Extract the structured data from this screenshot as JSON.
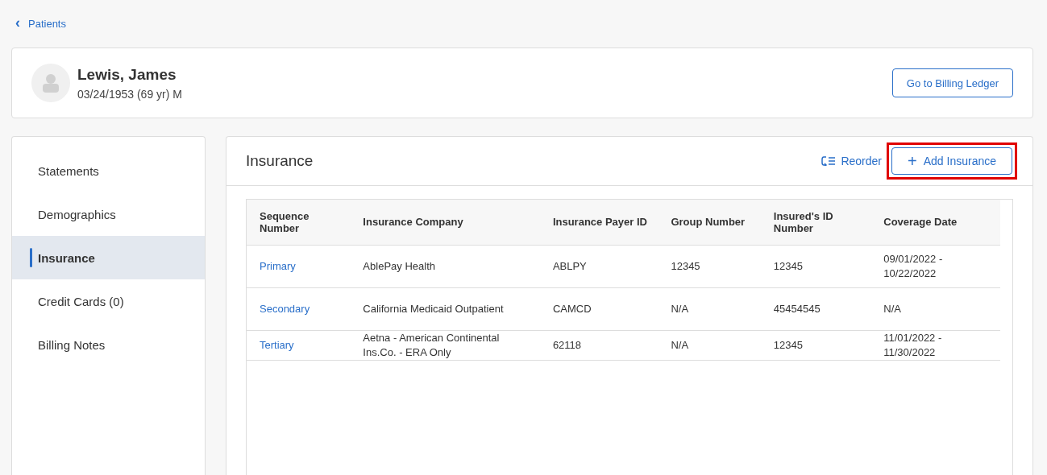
{
  "back_link": {
    "icon": "‹",
    "label": "Patients"
  },
  "patient": {
    "name": "Lewis, James",
    "details": "03/24/1953 (69 yr) M",
    "action": "Go to Billing Ledger"
  },
  "sidebar": {
    "items": [
      {
        "label": "Statements",
        "selected": false
      },
      {
        "label": "Demographics",
        "selected": false
      },
      {
        "label": "Insurance",
        "selected": true
      },
      {
        "label": "Credit Cards (0)",
        "selected": false
      },
      {
        "label": "Billing Notes",
        "selected": false
      }
    ]
  },
  "panel": {
    "title": "Insurance",
    "reorder": "Reorder",
    "add_button": {
      "icon": "+",
      "label": "Add Insurance",
      "highlighted": true
    }
  },
  "table": {
    "columns": [
      "Sequence Number",
      "Insurance Company",
      "Insurance Payer ID",
      "Group Number",
      "Insured's ID Number",
      "Coverage Date"
    ],
    "rows": [
      [
        "Primary",
        "AblePay Health",
        "ABLPY",
        "12345",
        "12345",
        "09/01/2022 - 10/22/2022"
      ],
      [
        "Secondary",
        "California Medicaid Outpatient",
        "CAMCD",
        "N/A",
        "45454545",
        "N/A"
      ],
      [
        "Tertiary",
        "Aetna - American Continental Ins.Co. - ERA Only",
        "62118",
        "N/A",
        "12345",
        "11/01/2022 - 11/30/2022"
      ]
    ]
  }
}
